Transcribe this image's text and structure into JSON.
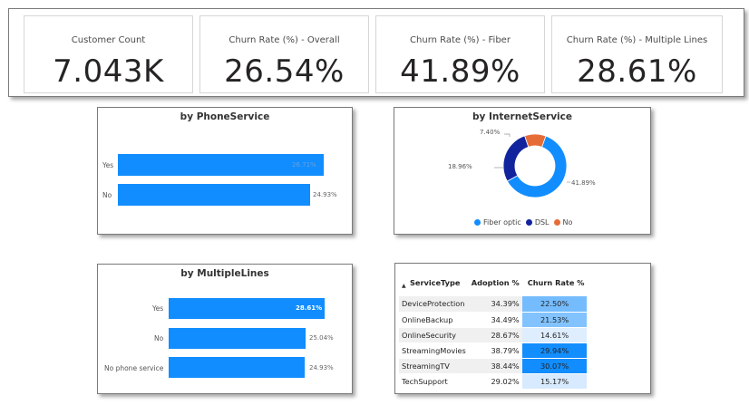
{
  "kpis": [
    {
      "label": "Customer Count",
      "value": "7.043K"
    },
    {
      "label": "Churn Rate (%) - Overall",
      "value": "26.54%"
    },
    {
      "label": "Churn Rate (%) - Fiber",
      "value": "41.89%"
    },
    {
      "label": "Churn Rate (%) - Multiple Lines",
      "value": "28.61%"
    }
  ],
  "phone_service": {
    "title": "by PhoneService",
    "rows": [
      {
        "label": "Yes",
        "value": 26.71,
        "display": "26.71%"
      },
      {
        "label": "No",
        "value": 24.93,
        "display": "24.93%"
      }
    ]
  },
  "internet_service": {
    "title": "by InternetService",
    "chart_data": {
      "type": "pie",
      "categories": [
        "Fiber optic",
        "DSL",
        "No"
      ],
      "values": [
        41.89,
        18.96,
        7.4
      ],
      "labels": [
        "41.89%",
        "18.96%",
        "7.40%"
      ],
      "colors": [
        "#118dff",
        "#12239e",
        "#e66c37"
      ],
      "legend_position": "bottom"
    }
  },
  "multiple_lines": {
    "title": "by MultipleLines",
    "rows": [
      {
        "label": "Yes",
        "value": 28.61,
        "display": "28.61%"
      },
      {
        "label": "No",
        "value": 25.04,
        "display": "25.04%"
      },
      {
        "label": "No phone service",
        "value": 24.93,
        "display": "24.93%"
      }
    ]
  },
  "service_table": {
    "headers": [
      "ServiceType",
      "Adoption %",
      "Churn Rate %"
    ],
    "rows": [
      {
        "service": "DeviceProtection",
        "adoption": "34.39%",
        "churn": "22.50%",
        "churn_value": 22.5
      },
      {
        "service": "OnlineBackup",
        "adoption": "34.49%",
        "churn": "21.53%",
        "churn_value": 21.53
      },
      {
        "service": "OnlineSecurity",
        "adoption": "28.67%",
        "churn": "14.61%",
        "churn_value": 14.61
      },
      {
        "service": "StreamingMovies",
        "adoption": "38.79%",
        "churn": "29.94%",
        "churn_value": 29.94
      },
      {
        "service": "StreamingTV",
        "adoption": "38.44%",
        "churn": "30.07%",
        "churn_value": 30.07
      },
      {
        "service": "TechSupport",
        "adoption": "29.02%",
        "churn": "15.17%",
        "churn_value": 15.17
      }
    ]
  }
}
